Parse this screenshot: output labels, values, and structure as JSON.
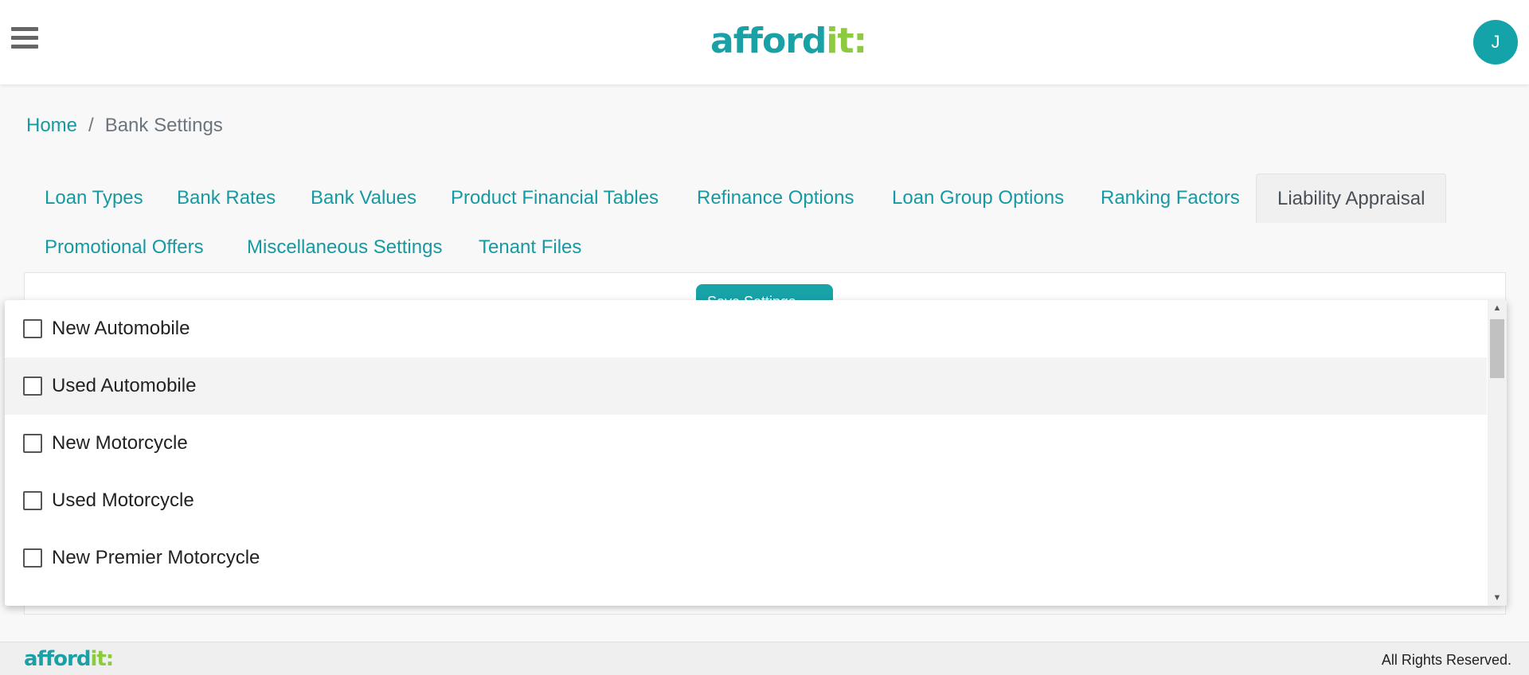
{
  "header": {
    "logo_main": "afford",
    "logo_accent": "it:",
    "avatar_initial": "J"
  },
  "breadcrumb": {
    "home": "Home",
    "separator": "/",
    "current": "Bank Settings"
  },
  "tabs": [
    {
      "label": "Loan Types"
    },
    {
      "label": "Bank Rates"
    },
    {
      "label": "Bank Values"
    },
    {
      "label": "Product Financial Tables"
    },
    {
      "label": "Refinance Options"
    },
    {
      "label": "Loan Group Options"
    },
    {
      "label": "Ranking Factors"
    },
    {
      "label": "Liability Appraisal",
      "active": true
    },
    {
      "label": "Promotional Offers"
    },
    {
      "label": "Miscellaneous Settings"
    },
    {
      "label": "Tenant Files"
    }
  ],
  "toolbar": {
    "save_label": "Save Settings"
  },
  "dropdown": {
    "options": [
      {
        "label": "New Automobile",
        "checked": false
      },
      {
        "label": "Used Automobile",
        "checked": false
      },
      {
        "label": "New Motorcycle",
        "checked": false
      },
      {
        "label": "Used Motorcycle",
        "checked": false
      },
      {
        "label": "New Premier Motorcycle",
        "checked": false
      }
    ]
  },
  "footer": {
    "logo_main": "afford",
    "logo_accent": "it:",
    "rights": "All Rights Reserved."
  },
  "colors": {
    "brand_teal": "#1aa1a6",
    "brand_green": "#8ccb3f",
    "link": "#1799a2"
  }
}
